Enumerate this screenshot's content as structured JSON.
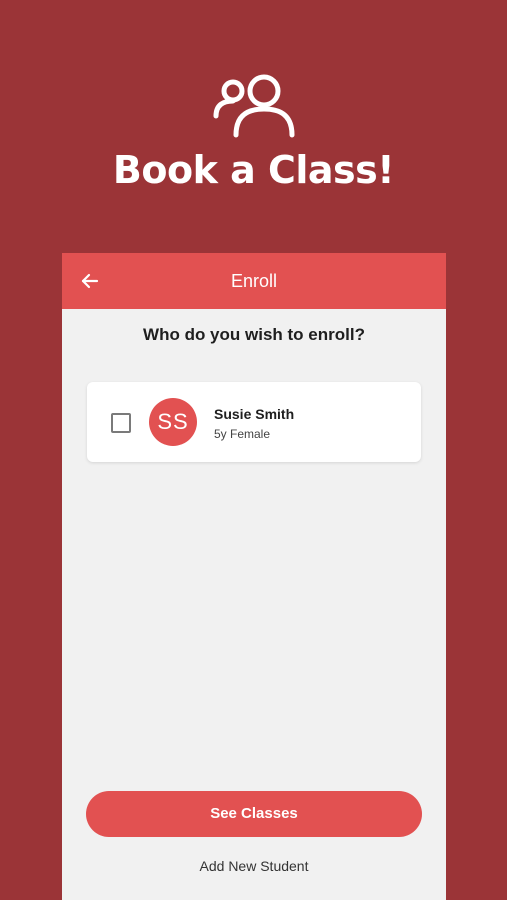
{
  "hero": {
    "icon": "users-icon",
    "title": "Book a Class!"
  },
  "appbar": {
    "back_icon": "arrow-left-icon",
    "title": "Enroll"
  },
  "enroll": {
    "question": "Who do you wish to enroll?",
    "students": [
      {
        "initials": "SS",
        "name": "Susie Smith",
        "details": "5y Female",
        "selected": false
      }
    ]
  },
  "actions": {
    "primary_label": "See Classes",
    "secondary_label": "Add New Student"
  },
  "colors": {
    "background": "#9b3437",
    "accent": "#e25151",
    "surface": "#f1f1f1",
    "card": "#ffffff"
  }
}
